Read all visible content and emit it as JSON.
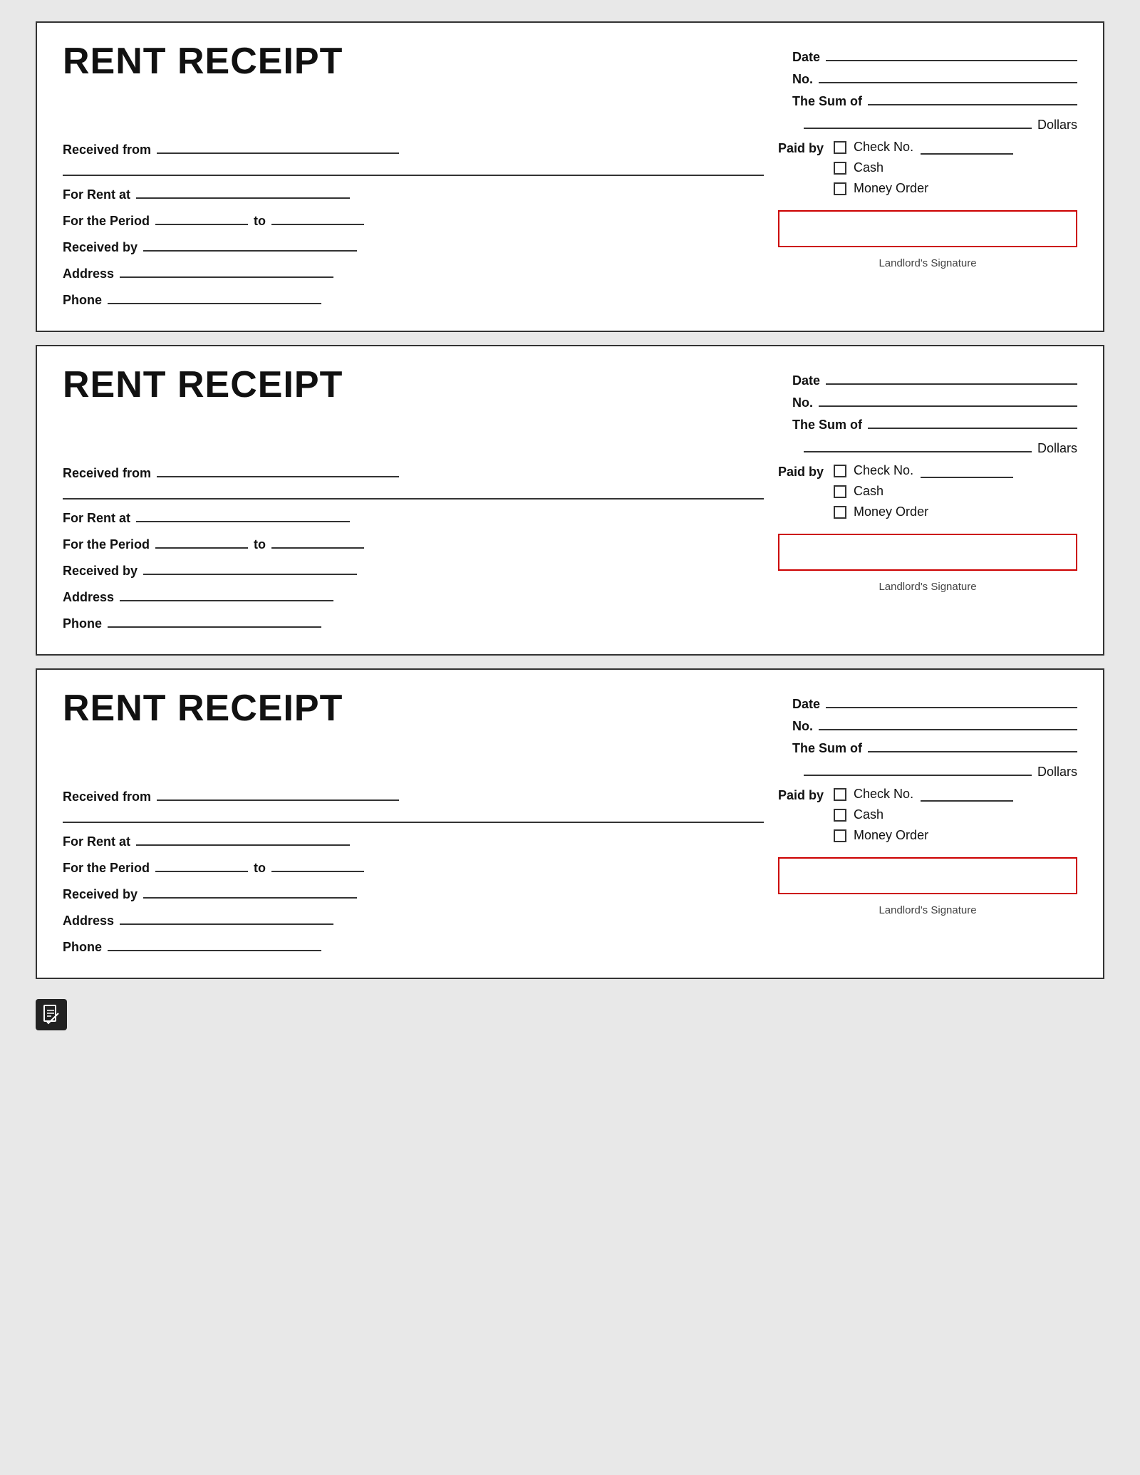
{
  "receipts": [
    {
      "id": 1,
      "title": "RENT RECEIPT",
      "date_label": "Date",
      "no_label": "No.",
      "sum_label": "The Sum of",
      "dollars_label": "Dollars",
      "received_from_label": "Received from",
      "for_rent_at_label": "For Rent at",
      "period_label": "For the Period",
      "to_label": "to",
      "received_by_label": "Received by",
      "address_label": "Address",
      "phone_label": "Phone",
      "paid_by_label": "Paid by",
      "check_no_label": "Check No.",
      "cash_label": "Cash",
      "money_order_label": "Money Order",
      "signature_label": "Landlord's Signature"
    },
    {
      "id": 2,
      "title": "RENT RECEIPT",
      "date_label": "Date",
      "no_label": "No.",
      "sum_label": "The Sum of",
      "dollars_label": "Dollars",
      "received_from_label": "Received from",
      "for_rent_at_label": "For Rent at",
      "period_label": "For the Period",
      "to_label": "to",
      "received_by_label": "Received by",
      "address_label": "Address",
      "phone_label": "Phone",
      "paid_by_label": "Paid by",
      "check_no_label": "Check No.",
      "cash_label": "Cash",
      "money_order_label": "Money Order",
      "signature_label": "Landlord's Signature"
    },
    {
      "id": 3,
      "title": "RENT RECEIPT",
      "date_label": "Date",
      "no_label": "No.",
      "sum_label": "The Sum of",
      "dollars_label": "Dollars",
      "received_from_label": "Received from",
      "for_rent_at_label": "For Rent at",
      "period_label": "For the Period",
      "to_label": "to",
      "received_by_label": "Received by",
      "address_label": "Address",
      "phone_label": "Phone",
      "paid_by_label": "Paid by",
      "check_no_label": "Check No.",
      "cash_label": "Cash",
      "money_order_label": "Money Order",
      "signature_label": "Landlord's Signature"
    }
  ],
  "footer": {
    "icon": "document-icon"
  }
}
